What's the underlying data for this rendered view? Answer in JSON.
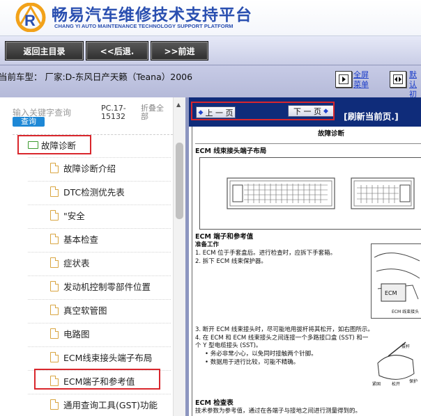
{
  "header": {
    "title": "畅易汽车维修技术支持平台",
    "subtitle": "CHANG YI AUTO MAINTENANCE TECHNOLOGY SUPPORT PLATFORM"
  },
  "toolbar": {
    "home_label": "返回主目录",
    "back_label": "<<后退.",
    "forward_label": ">>前进"
  },
  "carbar": {
    "car_info": "当前车型：  厂家:D-东风日产天籁（Teana）2006",
    "fullscreen_line1": "全屏",
    "fullscreen_line2": "菜单",
    "default_line1": "默认",
    "default_line2": "初始"
  },
  "sidebar": {
    "search_placeholder": "输入关键字查询",
    "query_label": "查询",
    "version_line1": "PC.17-",
    "version_line2": "15132",
    "collapse_line1": "折叠全",
    "collapse_line2": "部",
    "folder_label": "故障诊断",
    "items": [
      {
        "label": "故障诊断介绍"
      },
      {
        "label": "DTC检测优先表"
      },
      {
        "label": "\"安全"
      },
      {
        "label": "基本检查"
      },
      {
        "label": "症状表"
      },
      {
        "label": "发动机控制零部件位置"
      },
      {
        "label": "真空软管图"
      },
      {
        "label": "电路图"
      },
      {
        "label": "ECM线束接头端子布局"
      },
      {
        "label": "ECM端子和参考值"
      },
      {
        "label": "通用查询工具(GST)功能"
      }
    ]
  },
  "document": {
    "prev_label": "上 一 页",
    "next_label": "下 一 页",
    "refresh_label": "[刷新当前页.]",
    "page_title": "故障诊断",
    "section1": "ECM 线束接头端子布局",
    "section2": "ECM 端子和参考值",
    "prep": "准备工作",
    "step1": "1.   ECM 位于手套盒后。进行检查时，应拆下手套箱。",
    "step2": "2.   拆下 ECM 线束保护器。",
    "step3": "3.   断开 ECM 线束接头时，尽可能地用拔杆将其松开，如右图所示。",
    "step4a": "4.   在 ECM 和 ECM 线束接头之间连接一个多路接口盒 (SST) 和一",
    "step4b": "      个 Y 型电缆接头 (SST)。",
    "bullet1": "•  务必非常小心，以免同时接触两个针脚。",
    "bullet2": "•  数据用于进行比较，可能不精确。",
    "section3": "ECM 检查表",
    "footer_text": "技术参数为参考值，通过在各端子与接地之间进行测量得到的。",
    "label_ecm": "ECM",
    "label_ecm_connector": "ECM 线束接头",
    "label_lever": "拔杆",
    "label_release": "松开",
    "label_fasten": "紧固",
    "label_protector": "保护"
  }
}
